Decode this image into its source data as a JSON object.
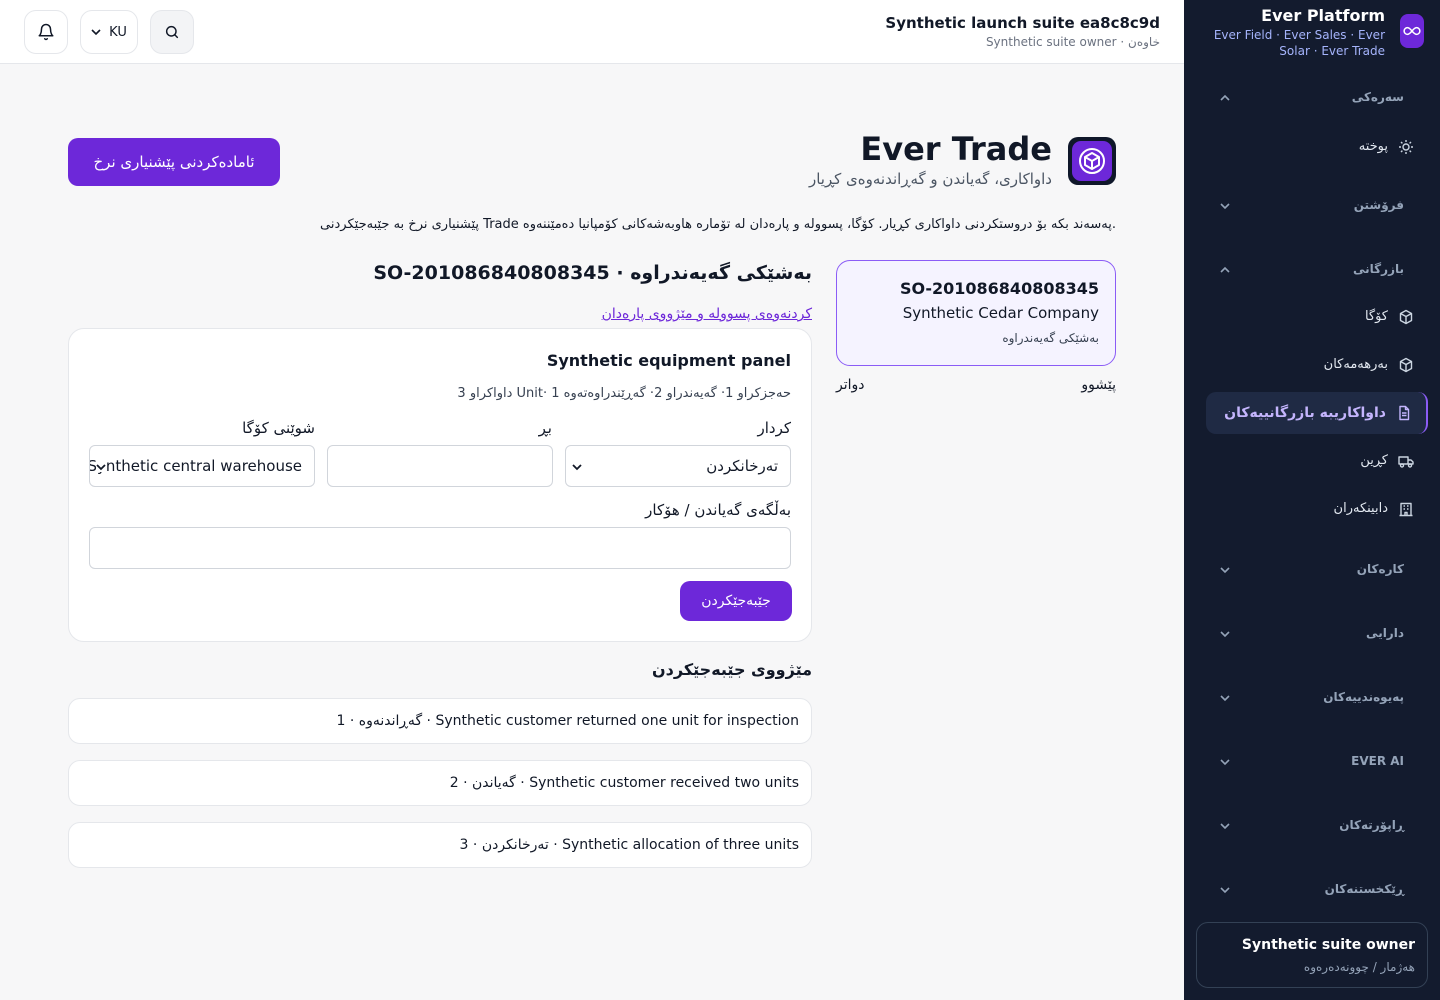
{
  "sidebar": {
    "brand_title": "Ever Platform",
    "brand_subtitle": "Ever Field · Ever Sales · Ever Solar · Ever Trade",
    "sections": [
      {
        "label": "سەرەکی"
      },
      {
        "label": "فرۆشتن"
      },
      {
        "label": "بازرگانی"
      },
      {
        "label": "کارەکان"
      },
      {
        "label": "دارایی"
      },
      {
        "label": "پەیوەندییەکان"
      },
      {
        "label": "EVER AI"
      },
      {
        "label": "ڕاپۆرتەکان"
      },
      {
        "label": "ڕێکخستنەکان"
      }
    ],
    "items": [
      {
        "label": "پوختە"
      },
      {
        "label": "کۆگا"
      },
      {
        "label": "بەرهەمەکان"
      },
      {
        "label": "داواکاریبە بازرگانییەکان"
      },
      {
        "label": "کڕین"
      },
      {
        "label": "دابینکەران"
      }
    ],
    "user_name": "Synthetic suite owner",
    "user_link": "هەژمار / چوونەدەرەوە"
  },
  "header": {
    "lang": "KU",
    "suite_title": "Synthetic launch suite ea8c8c9d",
    "suite_subtitle": "Synthetic suite owner · خاوەن"
  },
  "module": {
    "title": "Ever Trade",
    "subtitle": "داواکاری، گەیاندن و گەڕاندنەوەی کڕیار",
    "cta": "ئامادەکردنی پێشنیاری نرخ",
    "intro": "پێشنیاری نرخ بە جێبەجێکردنی Trade پەسەند بکە بۆ دروستکردنی داواکاری کڕیار. کۆگا، پسوولە و پارەدان لە تۆمارە هاوبەشەکانی کۆمپانیا دەمێننەوە."
  },
  "order_card": {
    "code": "SO-201086840808345",
    "company": "Synthetic Cedar Company",
    "status": "بەشێکی گەیەندراوە",
    "prev": "پێشوو",
    "next": "دواتر"
  },
  "detail": {
    "title": "SO-201086840808345 · بەشێکی گەیەندراوە",
    "link": "کردنەوەی پسوولە و مێژووی پارەدان"
  },
  "panel": {
    "title": "Synthetic equipment panel",
    "stats": "داواکراو 3 Unit· حەجزکراو 1· گەیەندراو 2· گەڕێندراوەتەوە 1",
    "action_label": "کردار",
    "action_value": "تەرخانکردن",
    "qty_label": "بڕ",
    "qty_value": "",
    "warehouse_label": "شوێنی کۆگا",
    "warehouse_value": "Synthetic central warehouse",
    "reason_label": "بەڵگەی گەیاندن / هۆکار",
    "reason_value": "",
    "submit": "جێبەجێکردن"
  },
  "history": {
    "title": "مێژووی جێبەجێکردن",
    "rows": [
      {
        "text": "گەڕاندنەوە · 1 · Synthetic customer returned one unit for inspection"
      },
      {
        "text": "گەیاندن · 2 · Synthetic customer received two units"
      },
      {
        "text": "تەرخانکردن · 3 · Synthetic allocation of three units"
      }
    ]
  },
  "colors": {
    "accent": "#6d28d9",
    "sidebar_bg": "#131b2e",
    "card_tint": "#f5f3ff"
  },
  "icons": [
    "bell-icon",
    "chevron-down-icon",
    "search-icon",
    "sun-icon",
    "box-icon",
    "document-icon",
    "truck-icon",
    "building-icon",
    "infinity-icon",
    "cube-cycle-icon"
  ]
}
